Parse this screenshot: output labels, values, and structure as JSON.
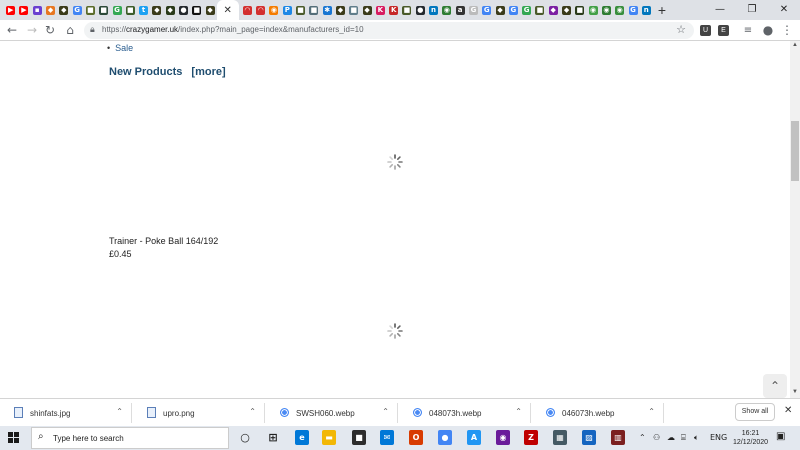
{
  "browser": {
    "tab_favicons": [
      {
        "name": "youtube-icon",
        "color": "#ff0000",
        "glyph": "▶"
      },
      {
        "name": "youtube-icon",
        "color": "#ff0000",
        "glyph": "▶"
      },
      {
        "name": "purple-box-icon",
        "color": "#6a3fd0",
        "glyph": "▪"
      },
      {
        "name": "orange-icon",
        "color": "#e87722",
        "glyph": "◆"
      },
      {
        "name": "game-icon",
        "color": "#3b3b1a",
        "glyph": "◆"
      },
      {
        "name": "google-icon",
        "color": "#4285f4",
        "glyph": "G"
      },
      {
        "name": "game-icon",
        "color": "#5a6b2a",
        "glyph": "■"
      },
      {
        "name": "game-icon",
        "color": "#2d4a3a",
        "glyph": "■"
      },
      {
        "name": "google-icon",
        "color": "#34a853",
        "glyph": "G"
      },
      {
        "name": "game-icon",
        "color": "#3e5d2a",
        "glyph": "■"
      },
      {
        "name": "twitter-icon",
        "color": "#1da1f2",
        "glyph": "t"
      },
      {
        "name": "game-icon",
        "color": "#3b3b1a",
        "glyph": "◆"
      },
      {
        "name": "game-icon",
        "color": "#2a3a1a",
        "glyph": "◆"
      },
      {
        "name": "github-icon",
        "color": "#24292e",
        "glyph": "●"
      },
      {
        "name": "media-icon",
        "color": "#111111",
        "glyph": "■"
      },
      {
        "name": "game-icon",
        "color": "#3b3b1a",
        "glyph": "◆"
      }
    ],
    "active_tab_close": "✕",
    "tab_favicons_right": [
      {
        "name": "red-wing-icon",
        "color": "#d32f2f",
        "glyph": "◠"
      },
      {
        "name": "red-wing-icon",
        "color": "#d32f2f",
        "glyph": "◠"
      },
      {
        "name": "rss-icon",
        "color": "#f57c00",
        "glyph": "◉"
      },
      {
        "name": "blue-p-icon",
        "color": "#1e88e5",
        "glyph": "P"
      },
      {
        "name": "game-icon",
        "color": "#4a5a2a",
        "glyph": "■"
      },
      {
        "name": "shop-icon",
        "color": "#546e7a",
        "glyph": "■"
      },
      {
        "name": "gear-icon",
        "color": "#1976d2",
        "glyph": "✱"
      },
      {
        "name": "game-icon",
        "color": "#3b3b1a",
        "glyph": "◆"
      },
      {
        "name": "shop-icon",
        "color": "#607d8b",
        "glyph": "■"
      },
      {
        "name": "game-icon",
        "color": "#3b3b1a",
        "glyph": "◆"
      },
      {
        "name": "k-icon",
        "color": "#d81b60",
        "glyph": "K"
      },
      {
        "name": "k-icon",
        "color": "#c62828",
        "glyph": "K"
      },
      {
        "name": "game-icon",
        "color": "#4a5a2a",
        "glyph": "■"
      },
      {
        "name": "github-icon",
        "color": "#24292e",
        "glyph": "●"
      },
      {
        "name": "n-icon",
        "color": "#0277bd",
        "glyph": "n"
      },
      {
        "name": "green-circle-icon",
        "color": "#2e7d32",
        "glyph": "◉"
      },
      {
        "name": "a-icon",
        "color": "#333333",
        "glyph": "a"
      },
      {
        "name": "google-icon",
        "color": "#bbbbbb",
        "glyph": "G"
      },
      {
        "name": "google-icon",
        "color": "#4285f4",
        "glyph": "G"
      },
      {
        "name": "game-icon",
        "color": "#3b3b1a",
        "glyph": "◆"
      },
      {
        "name": "google-icon",
        "color": "#4285f4",
        "glyph": "G"
      },
      {
        "name": "google-icon",
        "color": "#34a853",
        "glyph": "G"
      },
      {
        "name": "game-icon",
        "color": "#4a5a2a",
        "glyph": "■"
      },
      {
        "name": "purple-icon",
        "color": "#7b1fa2",
        "glyph": "◆"
      },
      {
        "name": "game-icon",
        "color": "#3b3b1a",
        "glyph": "◆"
      },
      {
        "name": "game-icon",
        "color": "#2a3a1a",
        "glyph": "■"
      },
      {
        "name": "green-leaf-icon",
        "color": "#43a047",
        "glyph": "◉"
      },
      {
        "name": "green-leaf-icon",
        "color": "#2e7d32",
        "glyph": "◉"
      },
      {
        "name": "green-leaf-icon",
        "color": "#388e3c",
        "glyph": "◉"
      },
      {
        "name": "google-icon",
        "color": "#4285f4",
        "glyph": "G"
      },
      {
        "name": "n-icon",
        "color": "#0277bd",
        "glyph": "n"
      }
    ],
    "new_tab": "+",
    "window_controls": {
      "minimize": "—",
      "restore": "❐",
      "close": "✕"
    },
    "url": {
      "prefix": "https://",
      "host": "crazygamer.uk",
      "path": "/index.php?main_page=index&manufacturers_id=10"
    },
    "extensions": [
      "U",
      "E"
    ]
  },
  "page": {
    "bullet_link": "Sale",
    "new_products_title": "New Products",
    "new_products_more": "[more]",
    "product": {
      "name": "Trainer - Poke Ball 164/192",
      "price": "£0.45"
    }
  },
  "downloads": {
    "items": [
      {
        "name": "shinfats.jpg",
        "icon": "file-icon"
      },
      {
        "name": "upro.png",
        "icon": "file-icon"
      },
      {
        "name": "SWSH060.webp",
        "icon": "chrome-file-icon"
      },
      {
        "name": "048073h.webp",
        "icon": "chrome-file-icon"
      },
      {
        "name": "046073h.webp",
        "icon": "chrome-file-icon"
      }
    ],
    "show_all": "Show all"
  },
  "taskbar": {
    "search_placeholder": "Type here to search",
    "apps": [
      {
        "name": "task-view-icon",
        "glyph": "○",
        "color": "#222222"
      },
      {
        "name": "timeline-icon",
        "glyph": "⊞",
        "color": "#222222"
      },
      {
        "name": "edge-icon",
        "glyph": "e",
        "color": "#0078d7"
      },
      {
        "name": "file-explorer-icon",
        "glyph": "▬",
        "color": "#f2b705"
      },
      {
        "name": "store-icon",
        "glyph": "■",
        "color": "#2d2d2d"
      },
      {
        "name": "mail-icon",
        "glyph": "✉",
        "color": "#0078d7"
      },
      {
        "name": "office-icon",
        "glyph": "O",
        "color": "#d83b01"
      },
      {
        "name": "chrome-icon",
        "glyph": "●",
        "color": "#4285f4"
      },
      {
        "name": "app-store-icon",
        "glyph": "A",
        "color": "#2196f3"
      },
      {
        "name": "media-icon",
        "glyph": "◉",
        "color": "#6a1b9a"
      },
      {
        "name": "filezilla-icon",
        "glyph": "Z",
        "color": "#bf0000"
      },
      {
        "name": "calculator-icon",
        "glyph": "▦",
        "color": "#455a64"
      },
      {
        "name": "photos-icon",
        "glyph": "▨",
        "color": "#1565c0"
      },
      {
        "name": "winrar-icon",
        "glyph": "▥",
        "color": "#7b1f1f"
      }
    ],
    "tray": {
      "chevron": "⌃",
      "language": "ENG",
      "time": "16:21",
      "date": "12/12/2020",
      "notification": "▣"
    }
  }
}
